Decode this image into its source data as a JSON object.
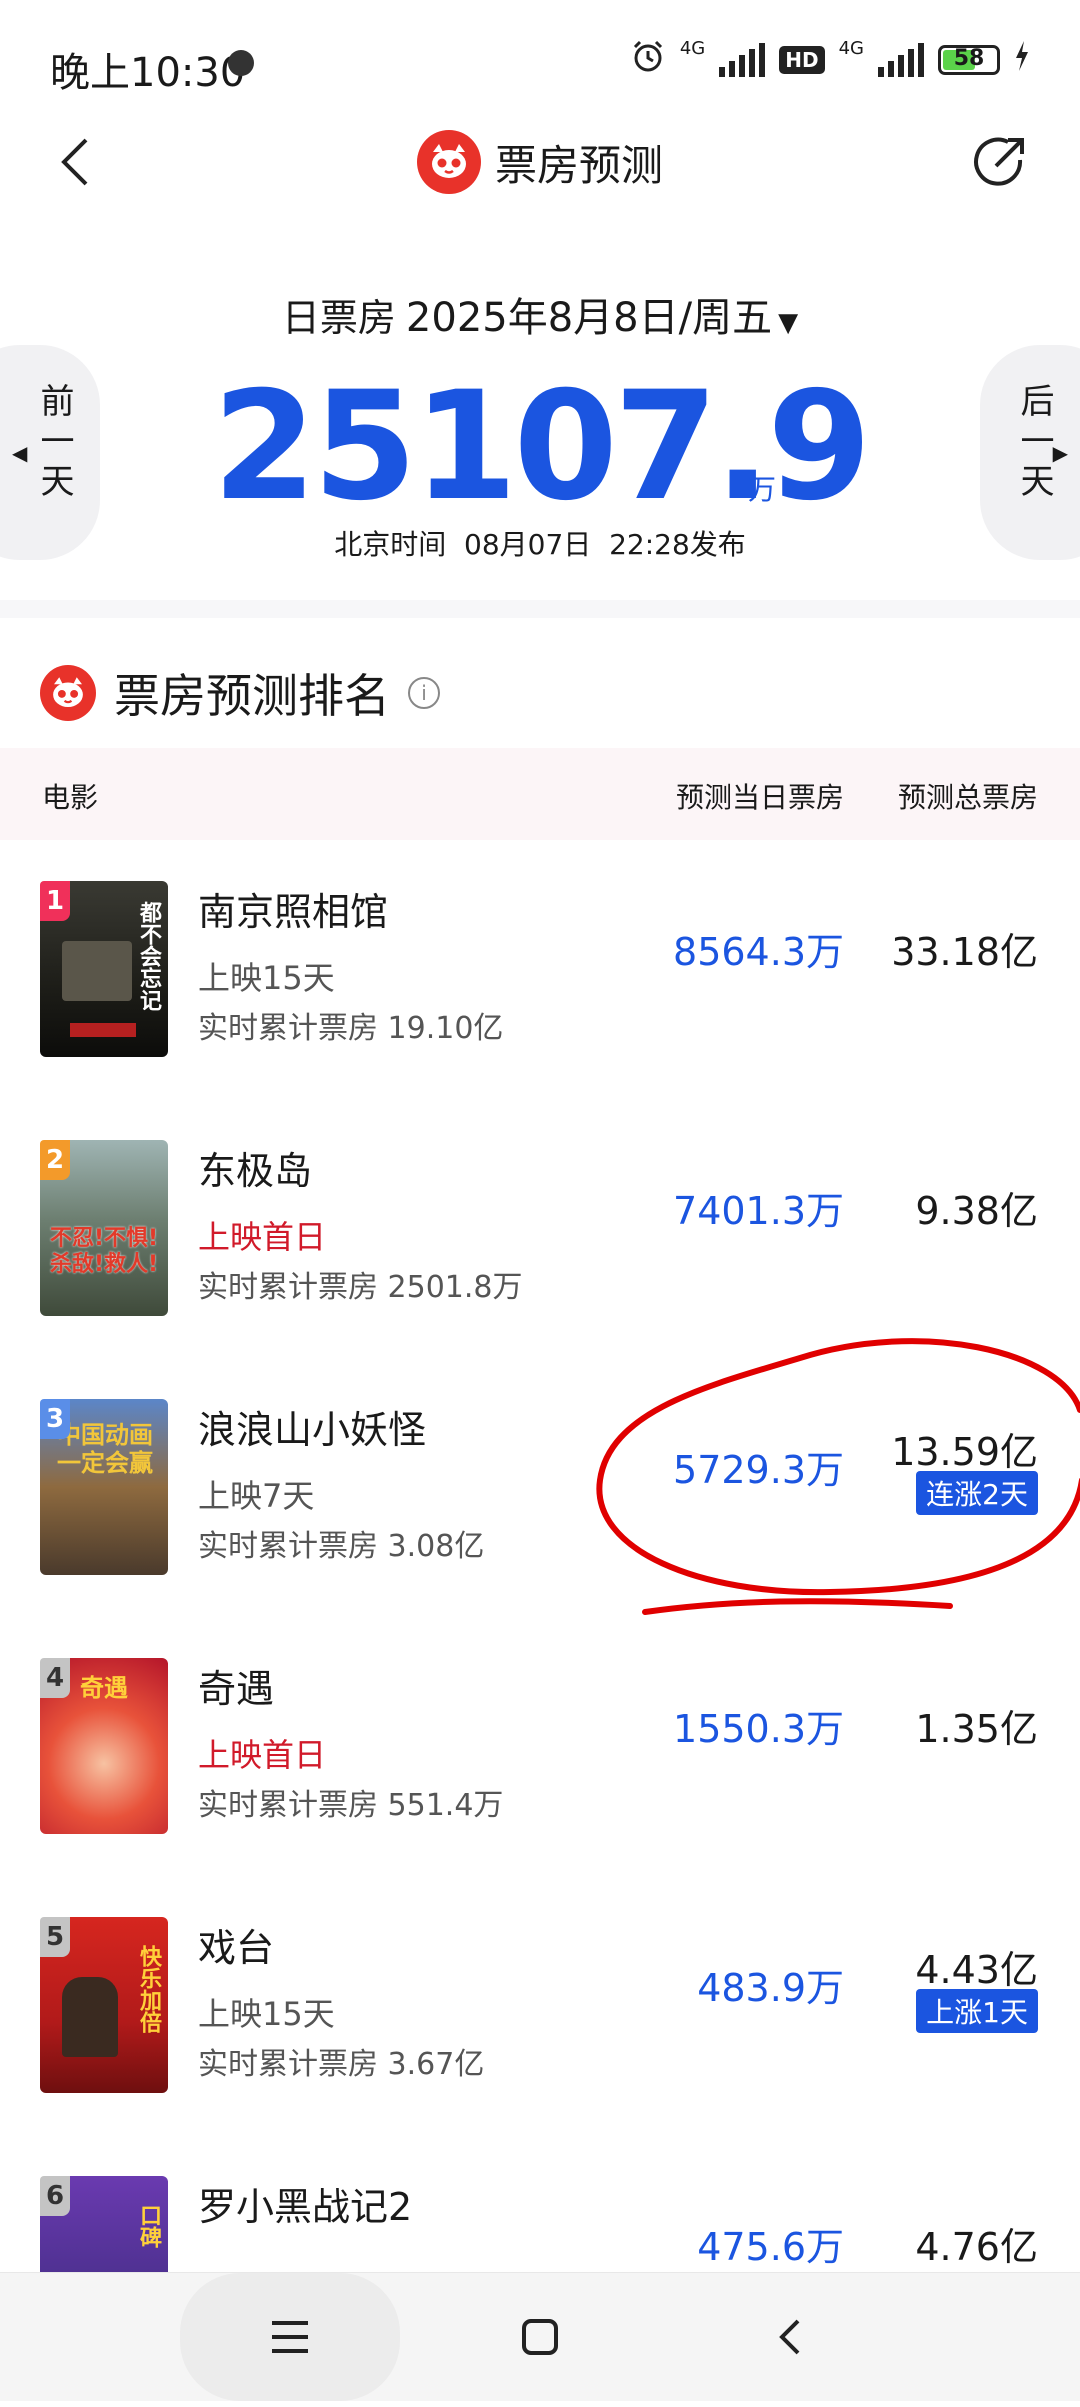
{
  "status_bar": {
    "time": "晚上10:30",
    "net1": "4G",
    "hd": "HD",
    "net2": "4G",
    "battery": "58"
  },
  "header": {
    "title": "票房预测"
  },
  "date_selector": {
    "label": "日票房",
    "date": "2025年8月8日/周五",
    "prev": "前一天",
    "next": "后一天"
  },
  "total": {
    "value": "25107.9",
    "unit": "万",
    "published": "北京时间  08月07日  22:28发布"
  },
  "ranking": {
    "title": "票房预测排名",
    "headers": {
      "movie": "电影",
      "day": "预测当日票房",
      "total": "预测总票房"
    },
    "movies": [
      {
        "rank": "1",
        "title": "南京照相馆",
        "days": "上映15天",
        "cumulative": "实时累计票房 19.10亿",
        "day_pred": "8564.3万",
        "total_pred": "33.18亿",
        "poster_text": "都不会忘记"
      },
      {
        "rank": "2",
        "title": "东极岛",
        "days": "上映首日",
        "cumulative": "实时累计票房 2501.8万",
        "day_pred": "7401.3万",
        "total_pred": "9.38亿",
        "poster_text": "不忍!不惧!杀敌!救人!"
      },
      {
        "rank": "3",
        "title": "浪浪山小妖怪",
        "days": "上映7天",
        "cumulative": "实时累计票房 3.08亿",
        "day_pred": "5729.3万",
        "total_pred": "13.59亿",
        "tag": "连涨2天",
        "poster_text": "中国动画一定会赢"
      },
      {
        "rank": "4",
        "title": "奇遇",
        "days": "上映首日",
        "cumulative": "实时累计票房 551.4万",
        "day_pred": "1550.3万",
        "total_pred": "1.35亿",
        "poster_text": "奇遇"
      },
      {
        "rank": "5",
        "title": "戏台",
        "days": "上映15天",
        "cumulative": "实时累计票房 3.67亿",
        "day_pred": "483.9万",
        "total_pred": "4.43亿",
        "tag": "上涨1天",
        "poster_text": "快乐加倍"
      },
      {
        "rank": "6",
        "title": "罗小黑战记2",
        "days": "",
        "cumulative": "",
        "day_pred": "475.6万",
        "total_pred": "4.76亿",
        "poster_text": "口碑"
      }
    ]
  },
  "colors": {
    "accent_blue": "#1b55e0",
    "brand_red": "#e8322a",
    "first_day_red": "#d11a2a",
    "annotation_red": "#e00000"
  }
}
